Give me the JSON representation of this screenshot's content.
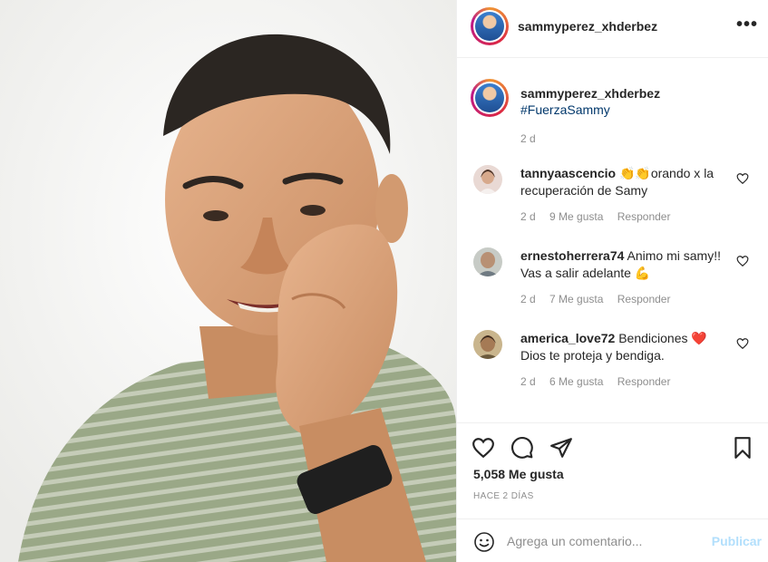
{
  "post": {
    "username": "sammyperez_xhderbez",
    "more_label": "•••",
    "caption": {
      "username": "sammyperez_xhderbez",
      "hashtag": "#FuerzaSammy",
      "time": "2 d"
    }
  },
  "comments": [
    {
      "username": "tannyaascencio",
      "text": " 👏👏orando x la recuperación de Samy",
      "time": "2 d",
      "likes": "9 Me gusta",
      "reply": "Responder"
    },
    {
      "username": "ernestoherrera74",
      "text": " Animo mi samy!! Vas a salir adelante 💪",
      "time": "2 d",
      "likes": "7 Me gusta",
      "reply": "Responder"
    },
    {
      "username": "america_love72",
      "text": " Bendiciones ❤️ Dios te proteja y bendiga.",
      "time": "2 d",
      "likes": "6 Me gusta",
      "reply": "Responder"
    }
  ],
  "actions": {
    "likes": "5,058 Me gusta",
    "ago": "HACE 2 DÍAS"
  },
  "add_comment": {
    "placeholder": "Agrega un comentario...",
    "publish": "Publicar"
  },
  "colors": {
    "link": "#00376b",
    "muted": "#8e8e8e",
    "publish_disabled": "#b2dffc",
    "text": "#262626",
    "heart_red": "#e0182d"
  }
}
